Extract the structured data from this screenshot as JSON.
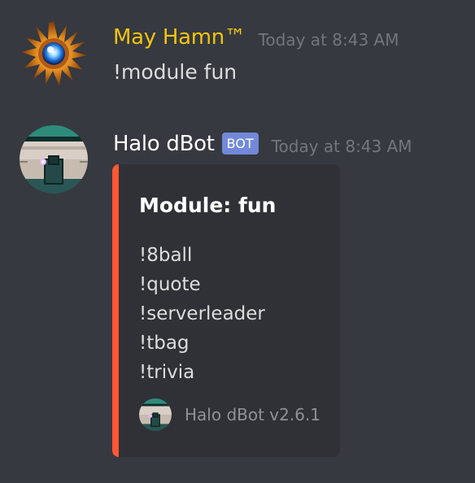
{
  "messages": [
    {
      "author": "May Hamn™",
      "author_color": "#f1c40f",
      "avatar_icon": "sunburst-avatar-icon",
      "timestamp": "Today at 8:43 AM",
      "text": "!module fun"
    },
    {
      "author": "Halo dBot",
      "author_color": "#ffffff",
      "avatar_icon": "halo-helmet-avatar-icon",
      "badge": "BOT",
      "timestamp": "Today at 8:43 AM",
      "embed": {
        "accent_color": "#ff5733",
        "title": "Module: fun",
        "items": [
          "!8ball",
          "!quote",
          "!serverleader",
          "!tbag",
          "!trivia"
        ],
        "footer_icon": "halo-helmet-icon",
        "footer_text": "Halo dBot v2.6.1"
      }
    }
  ],
  "colors": {
    "background": "#36393f",
    "embed_background": "#2f3136",
    "bot_badge": "#7289da",
    "timestamp": "#72767d"
  }
}
